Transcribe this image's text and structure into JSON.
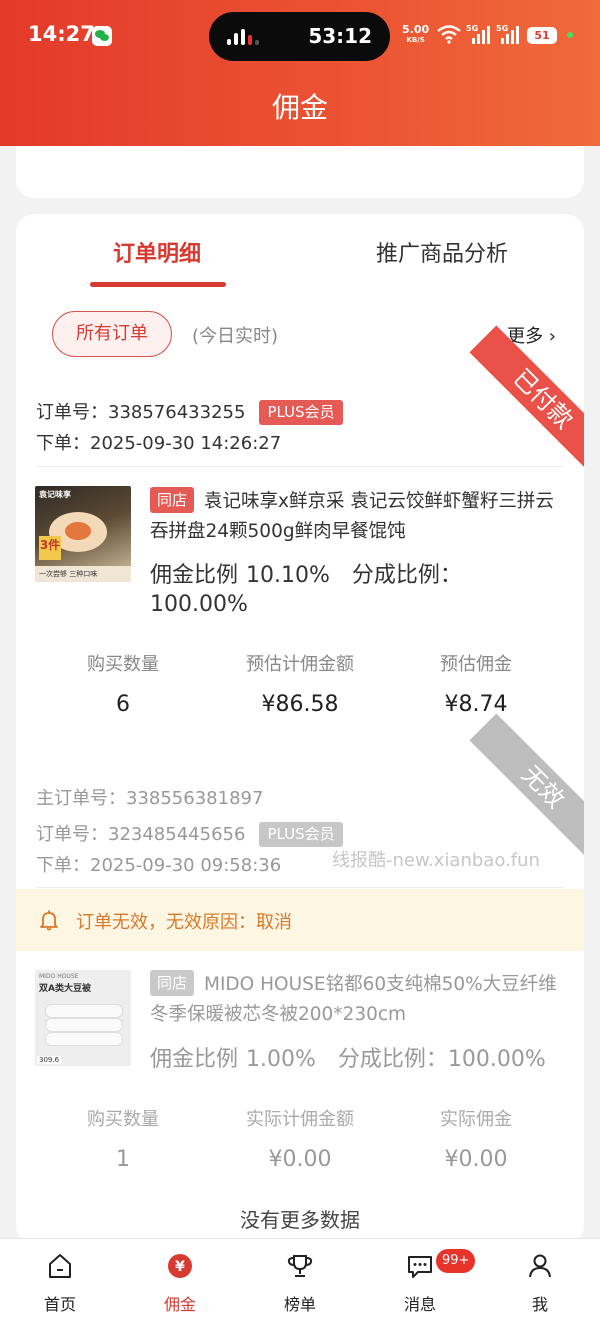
{
  "status_bar": {
    "time": "14:27",
    "call_timer": "53:12",
    "net_speed": "5.00",
    "net_unit": "KB/S",
    "signal1_label": "5G",
    "signal2_label": "5G",
    "battery": "51"
  },
  "header": {
    "title": "佣金"
  },
  "tabs": [
    {
      "label": "订单明细",
      "active": true
    },
    {
      "label": "推广商品分析",
      "active": false
    }
  ],
  "filter": {
    "selected": "所有订单",
    "note": "(今日实时)",
    "more": "更多 ›"
  },
  "orders": [
    {
      "status": "已付款",
      "order_no_label": "订单号：",
      "order_no": "338576433255",
      "member_badge": "PLUS会员",
      "placed_label": "下单：",
      "placed_time": "2025-09-30 14:26:27",
      "product": {
        "shop_tag": "同店",
        "title": "袁记味享x鲜京采 袁记云饺鲜虾蟹籽三拼云吞拼盘24颗500g鲜肉早餐馄饨",
        "thumb_brand": "袁记味享",
        "thumb_badge": "3件",
        "thumb_foot": "一次尝够 三种口味"
      },
      "commission_rate_label": "佣金比例",
      "commission_rate": "10.10%",
      "split_label": "分成比例：",
      "split_rate": "100.00%",
      "stats": [
        {
          "label": "购买数量",
          "value": "6"
        },
        {
          "label": "预估计佣金额",
          "value": "¥86.58"
        },
        {
          "label": "预估佣金",
          "value": "¥8.74"
        }
      ]
    },
    {
      "status": "无效",
      "main_order_label": "主订单号：",
      "main_order_no": "338556381897",
      "order_no_label": "订单号：",
      "order_no": "323485445656",
      "member_badge": "PLUS会员",
      "placed_label": "下单：",
      "placed_time": "2025-09-30 09:58:36",
      "warning": "订单无效，无效原因：取消",
      "product": {
        "shop_tag": "同店",
        "title": "MIDO HOUSE铭都60支纯棉50%大豆纤维冬季保暖被芯冬被200*230cm",
        "thumb_brand": "MIDO HOUSE",
        "thumb_title": "双A类大豆被",
        "thumb_price": "309.6"
      },
      "commission_rate_label": "佣金比例",
      "commission_rate": "1.00%",
      "split_label": "分成比例：",
      "split_rate": "100.00%",
      "stats": [
        {
          "label": "购买数量",
          "value": "1"
        },
        {
          "label": "实际计佣金额",
          "value": "¥0.00"
        },
        {
          "label": "实际佣金",
          "value": "¥0.00"
        }
      ]
    }
  ],
  "watermark": "线报酷-new.xianbao.fun",
  "no_more": "没有更多数据",
  "bottom_nav": [
    {
      "label": "首页",
      "icon": "home-icon",
      "active": false
    },
    {
      "label": "佣金",
      "icon": "yen-coin-icon",
      "active": true
    },
    {
      "label": "榜单",
      "icon": "trophy-icon",
      "active": false
    },
    {
      "label": "消息",
      "icon": "message-icon",
      "active": false,
      "badge": "99+"
    },
    {
      "label": "我",
      "icon": "user-icon",
      "active": false
    }
  ],
  "colors": {
    "brand_red": "#d73a31",
    "header_gradient_start": "#e33a2a",
    "header_gradient_end": "#f06a3a",
    "warning_bg": "#fdf6e3",
    "warning_text": "#d97a2a"
  }
}
